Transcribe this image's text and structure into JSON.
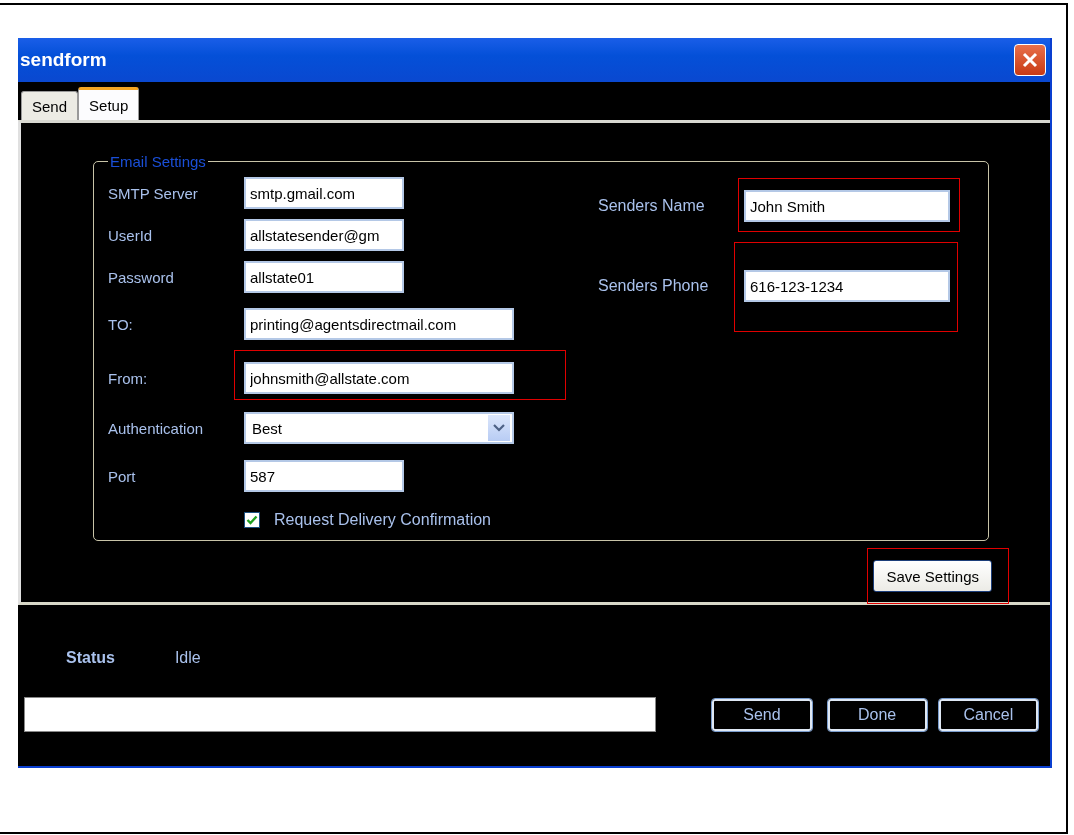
{
  "window": {
    "title": "sendform"
  },
  "tabs": [
    {
      "label": "Send",
      "selected": false
    },
    {
      "label": "Setup",
      "selected": true
    }
  ],
  "group": {
    "title": "Email Settings"
  },
  "fields": [
    {
      "kind": "text",
      "label": "SMTP Server",
      "value": "smtp.gmail.com",
      "wide": false,
      "highlighted": false
    },
    {
      "kind": "text",
      "label": "UserId",
      "value": "allstatesender@gm",
      "wide": false,
      "highlighted": false
    },
    {
      "kind": "text",
      "label": "Password",
      "value": "allstate01",
      "wide": false,
      "highlighted": false
    },
    {
      "kind": "text",
      "label": "TO:",
      "value": "printing@agentsdirectmail.com",
      "wide": true,
      "highlighted": false
    },
    {
      "kind": "text",
      "label": "From:",
      "value": "johnsmith@allstate.com",
      "wide": true,
      "highlighted": true
    },
    {
      "kind": "dropdown",
      "label": "Authentication",
      "value": "Best",
      "wide": true,
      "highlighted": false
    },
    {
      "kind": "text",
      "label": "Port",
      "value": "587",
      "wide": false,
      "highlighted": false
    },
    {
      "kind": "checkbox",
      "label": "Request Delivery Confirmation",
      "checked": true
    }
  ],
  "sender_fields": [
    {
      "label": "Senders Name",
      "value": "John Smith",
      "highlighted": true
    },
    {
      "label": "Senders Phone",
      "value": "616-123-1234",
      "highlighted": true
    }
  ],
  "save_button": {
    "label": "Save Settings",
    "highlighted": true
  },
  "status": {
    "label": "Status",
    "value": "Idle"
  },
  "buttons": [
    "Send",
    "Done",
    "Cancel"
  ]
}
